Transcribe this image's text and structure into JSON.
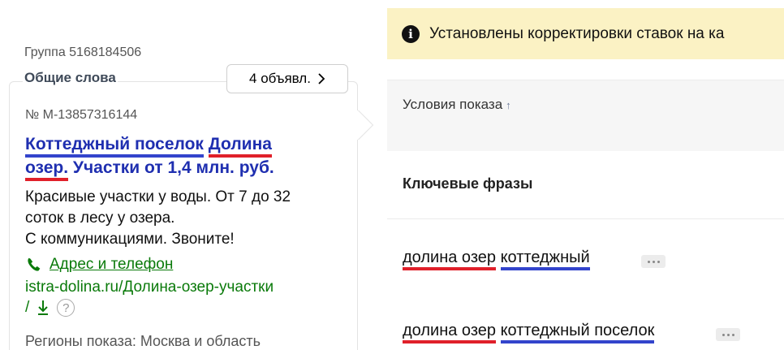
{
  "group": {
    "label": "Группа 5168184506",
    "common_words": "Общие слова",
    "ads_count_label": "4 объявл."
  },
  "ad": {
    "number": "№ М-13857316144",
    "title": {
      "part1": "Коттеджный поселок",
      "part2": "Долина",
      "part3": "озер.",
      "part4": " Участки от 1,4 млн. руб."
    },
    "text_lines": [
      "Красивые участки у воды. От 7 до 32",
      "соток в лесу у озера.",
      "С коммуникациями. Звоните!"
    ],
    "contacts_link": "Адрес и телефон",
    "site_url": "istra-dolina.ru/Долина-озер-участки",
    "path_sep": "/",
    "help_glyph": "?",
    "regions": "Регионы показа: Москва и область"
  },
  "notice": {
    "icon": "info-icon",
    "text": "Установлены корректировки ставок на ка"
  },
  "table": {
    "sort_label": "Условия показа",
    "sort_arrow": "↑",
    "section_title": "Ключевые фразы",
    "keywords": [
      {
        "part_red": "долина озер",
        "part_blue": "коттеджный"
      },
      {
        "part_red": "долина озер",
        "part_blue": "коттеджный поселок"
      }
    ]
  },
  "colors": {
    "underline_red": "#e0202a",
    "underline_blue": "#3344cc",
    "title_blue": "#1f2fb0",
    "green": "#0a7a0a",
    "notice_bg": "#fbf2c4"
  }
}
